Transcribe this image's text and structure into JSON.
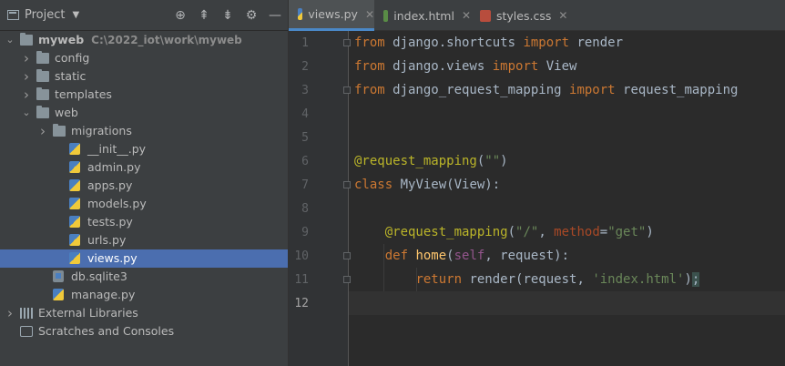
{
  "project_panel": {
    "title": "Project",
    "toolbar_icons": [
      "crosshair-icon",
      "expand-icon",
      "collapse-icon",
      "gear-icon",
      "minimize-icon"
    ]
  },
  "tree": [
    {
      "label": "myweb",
      "path": "C:\\2022_iot\\work\\myweb",
      "depth": 0,
      "type": "folder",
      "expanded": true
    },
    {
      "label": "config",
      "depth": 1,
      "type": "folder",
      "expanded": false
    },
    {
      "label": "static",
      "depth": 1,
      "type": "folder",
      "expanded": false
    },
    {
      "label": "templates",
      "depth": 1,
      "type": "folder",
      "expanded": false
    },
    {
      "label": "web",
      "depth": 1,
      "type": "folder",
      "expanded": true
    },
    {
      "label": "migrations",
      "depth": 2,
      "type": "folder",
      "expanded": false
    },
    {
      "label": "__init__.py",
      "depth": 3,
      "type": "py"
    },
    {
      "label": "admin.py",
      "depth": 3,
      "type": "py"
    },
    {
      "label": "apps.py",
      "depth": 3,
      "type": "py"
    },
    {
      "label": "models.py",
      "depth": 3,
      "type": "py"
    },
    {
      "label": "tests.py",
      "depth": 3,
      "type": "py"
    },
    {
      "label": "urls.py",
      "depth": 3,
      "type": "py"
    },
    {
      "label": "views.py",
      "depth": 3,
      "type": "py",
      "selected": true
    },
    {
      "label": "db.sqlite3",
      "depth": 2,
      "type": "db"
    },
    {
      "label": "manage.py",
      "depth": 2,
      "type": "py"
    },
    {
      "label": "External Libraries",
      "depth": 0,
      "type": "lib",
      "expanded": false
    },
    {
      "label": "Scratches and Consoles",
      "depth": 0,
      "type": "scratch"
    }
  ],
  "tabs": [
    {
      "label": "views.py",
      "kind": "py",
      "active": true
    },
    {
      "label": "index.html",
      "kind": "html",
      "active": false
    },
    {
      "label": "styles.css",
      "kind": "css",
      "active": false
    }
  ],
  "editor": {
    "line_numbers": [
      "1",
      "2",
      "3",
      "4",
      "5",
      "6",
      "7",
      "8",
      "9",
      "10",
      "11",
      "12"
    ],
    "lines": [
      [
        {
          "t": "from",
          "c": "kw"
        },
        {
          "t": " django.shortcuts "
        },
        {
          "t": "import",
          "c": "kw"
        },
        {
          "t": " render"
        }
      ],
      [
        {
          "t": "from",
          "c": "kw"
        },
        {
          "t": " django.views "
        },
        {
          "t": "import",
          "c": "kw"
        },
        {
          "t": " View"
        }
      ],
      [
        {
          "t": "from",
          "c": "kw"
        },
        {
          "t": " django_request_mapping "
        },
        {
          "t": "import",
          "c": "kw"
        },
        {
          "t": " request_mapping"
        }
      ],
      [],
      [],
      [
        {
          "t": "@request_mapping",
          "c": "deco"
        },
        {
          "t": "("
        },
        {
          "t": "\"\"",
          "c": "str"
        },
        {
          "t": ")"
        }
      ],
      [
        {
          "t": "class",
          "c": "kw"
        },
        {
          "t": " MyView(View):"
        }
      ],
      [],
      [
        {
          "t": "    "
        },
        {
          "t": "@request_mapping",
          "c": "deco"
        },
        {
          "t": "("
        },
        {
          "t": "\"/\"",
          "c": "str"
        },
        {
          "t": ", "
        },
        {
          "t": "method",
          "c": "param"
        },
        {
          "t": "="
        },
        {
          "t": "\"get\"",
          "c": "str"
        },
        {
          "t": ")"
        }
      ],
      [
        {
          "t": "    "
        },
        {
          "t": "def",
          "c": "kw"
        },
        {
          "t": " "
        },
        {
          "t": "home",
          "c": "func"
        },
        {
          "t": "("
        },
        {
          "t": "self",
          "c": "selfk"
        },
        {
          "t": ", request):"
        }
      ],
      [
        {
          "t": "        "
        },
        {
          "t": "return",
          "c": "kw"
        },
        {
          "t": " render(request, "
        },
        {
          "t": "'index.html'",
          "c": "str"
        },
        {
          "t": ")"
        },
        {
          "t": ";",
          "c": "caret-hl"
        }
      ],
      []
    ],
    "current_line": "12"
  }
}
